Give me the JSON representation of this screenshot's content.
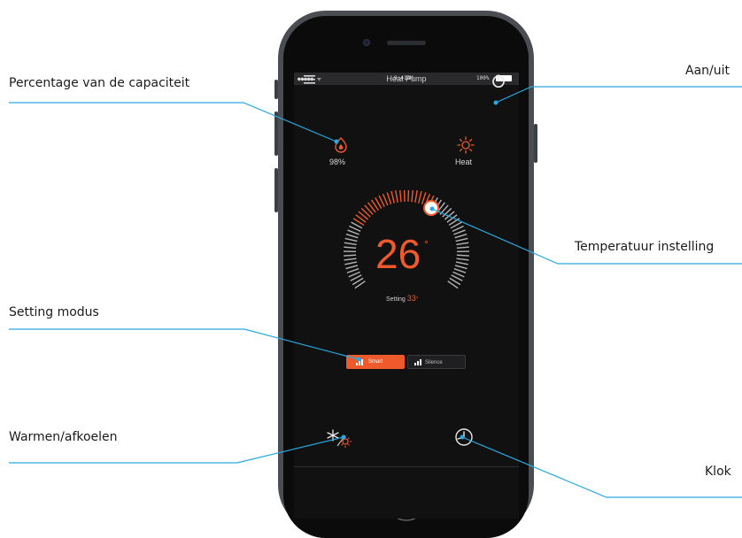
{
  "app": {
    "title": "Heat Pump",
    "status_bar": {
      "signal": "●●●●● ᯤ",
      "time": "9:41AM",
      "battery": "100%"
    }
  },
  "capacity": {
    "value": "98%"
  },
  "mode_indicator": {
    "label": "Heat"
  },
  "temperature": {
    "value": "26",
    "unit": "°",
    "setting_label": "Setting",
    "setting_value": "33",
    "setting_unit": "°"
  },
  "setting_modes": [
    {
      "label": "Smart",
      "active": true
    },
    {
      "label": "Silence",
      "active": false
    }
  ],
  "callouts": {
    "capacity": "Percentage van de capaciteit",
    "power": "Aan/uit",
    "temperature": "Temperatuur instelling",
    "mode": "Setting modus",
    "heat_cool": "Warmen/afkoelen",
    "clock": "Klok"
  },
  "colors": {
    "accent": "#ee5a2c",
    "callout_line": "#29a9e0",
    "screen_bg": "#111112",
    "dial_inactive": "#b5b5b5"
  },
  "icons": {
    "menu": "hamburger-menu-icon",
    "power": "power-icon",
    "capacity": "flame-capacity-icon",
    "heat": "sun-icon",
    "heat_cool": "snowflake-sun-icon",
    "clock": "clock-icon",
    "signal": "signal-bars-icon"
  }
}
